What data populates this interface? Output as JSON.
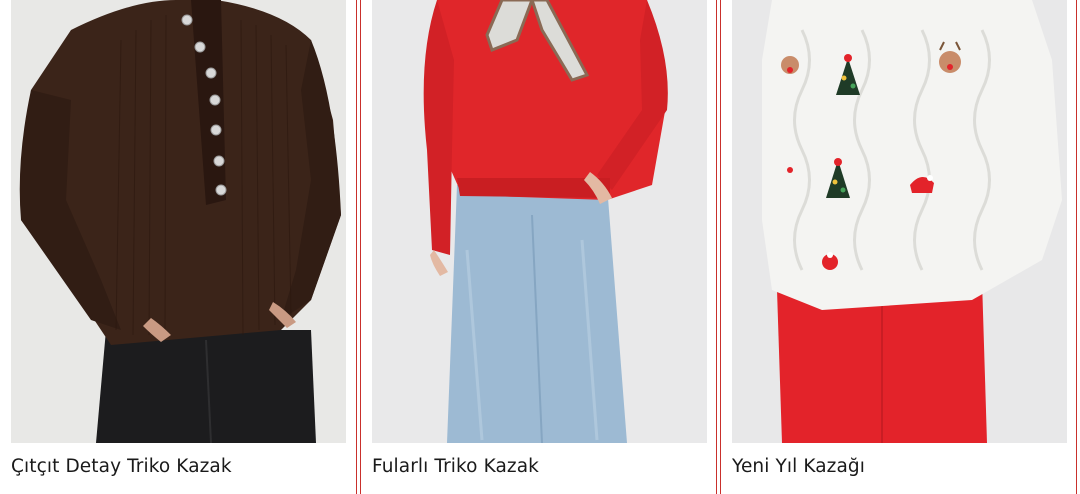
{
  "products": [
    {
      "title": "Çıtçıt Detay Triko Kazak",
      "image_icon": "product-photo-brown-knit-sweater"
    },
    {
      "title": "Fularlı Triko Kazak",
      "image_icon": "product-photo-red-sweater-scarf"
    },
    {
      "title": "Yeni Yıl Kazağı",
      "image_icon": "product-photo-white-christmas-sweater"
    }
  ],
  "colors": {
    "accent": "#d32f2f",
    "divider": "#c9302c",
    "text": "#1a1a1a"
  }
}
